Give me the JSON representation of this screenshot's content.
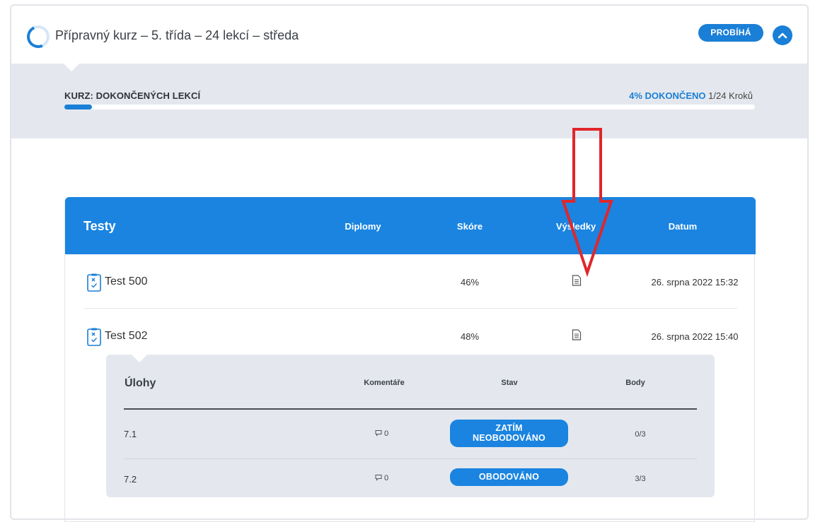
{
  "course": {
    "title": "Přípravný kurz – 5. třída – 24 lekcí – středa",
    "status": "PROBÍHÁ"
  },
  "progress": {
    "label": "KURZ: DOKONČENÝCH LEKCÍ",
    "percent_text": "4% DOKONČENO",
    "steps_text": "1/24 Kroků",
    "fraction": 0.04
  },
  "tests": {
    "headers": {
      "title": "Testy",
      "diplomas": "Diplomy",
      "score": "Skóre",
      "results": "Výsledky",
      "date": "Datum"
    },
    "rows": [
      {
        "name": "Test 500",
        "score": "46%",
        "date": "26. srpna 2022 15:32"
      },
      {
        "name": "Test 502",
        "score": "48%",
        "date": "26. srpna 2022 15:40"
      }
    ]
  },
  "tasks": {
    "headers": {
      "title": "Úlohy",
      "comments": "Komentáře",
      "status": "Stav",
      "points": "Body"
    },
    "rows": [
      {
        "number": "7.1",
        "comments": "0",
        "status_line1": "ZATÍM",
        "status_line2": "NEOBODOVÁNO",
        "points": "0/3"
      },
      {
        "number": "7.2",
        "comments": "0",
        "status_line1": "OBODOVÁNO",
        "status_line2": "",
        "points": "3/3"
      }
    ]
  },
  "colors": {
    "accent": "#1a84e0",
    "band": "#e4e8ee",
    "annotation": "#e0262b"
  },
  "icons": [
    "loading-spinner-icon",
    "chevron-up-icon",
    "quiz-icon",
    "document-icon",
    "comment-icon",
    "red-arrow-annotation"
  ]
}
